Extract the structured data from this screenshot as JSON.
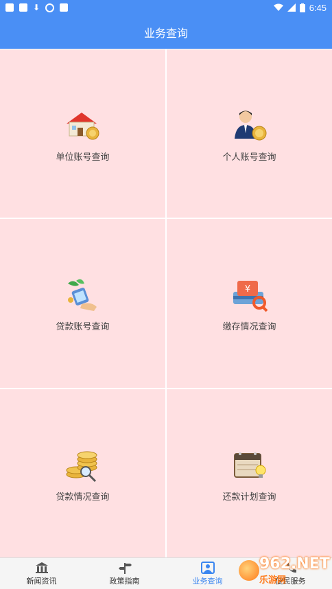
{
  "status_bar": {
    "time": "6:45",
    "left_icons": [
      "app-icon",
      "image-icon",
      "download-icon",
      "circle-icon",
      "a-icon"
    ],
    "right_icons": [
      "wifi-icon",
      "signal-icon",
      "battery-icon"
    ]
  },
  "header": {
    "title": "业务查询"
  },
  "grid": {
    "items": [
      {
        "label": "单位账号查询",
        "icon": "house-coin-icon"
      },
      {
        "label": "个人账号查询",
        "icon": "person-coin-icon"
      },
      {
        "label": "贷款账号查询",
        "icon": "money-hand-icon"
      },
      {
        "label": "缴存情况查询",
        "icon": "card-search-icon"
      },
      {
        "label": "贷款情况查询",
        "icon": "coins-search-icon"
      },
      {
        "label": "还款计划查询",
        "icon": "calendar-bulb-icon"
      }
    ]
  },
  "bottom_nav": {
    "items": [
      {
        "label": "新闻资讯",
        "icon": "building-icon"
      },
      {
        "label": "政策指南",
        "icon": "signpost-icon"
      },
      {
        "label": "业务查询",
        "icon": "person-card-icon",
        "active": true
      },
      {
        "label": "便民服务",
        "icon": "phone-icon"
      }
    ]
  },
  "watermark": {
    "top": "962.NET",
    "bottom": "乐游网"
  },
  "colors": {
    "primary": "#4a8ff5",
    "grid_bg": "#ffe0e2",
    "active_nav": "#3a86f0"
  }
}
